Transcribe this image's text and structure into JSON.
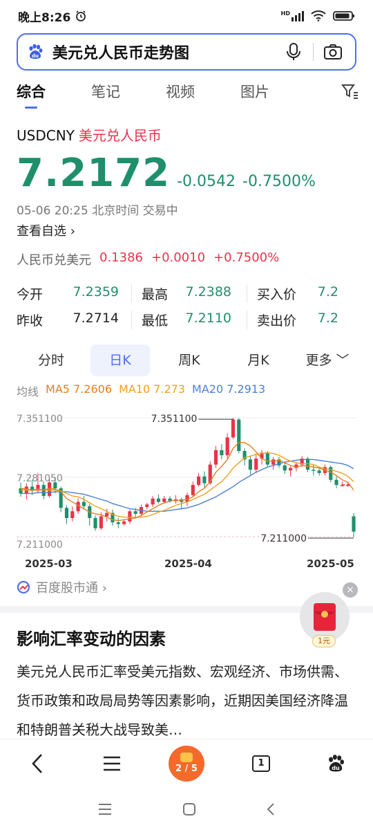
{
  "status": {
    "time": "晚上8:26",
    "net": "HD"
  },
  "search": {
    "query": "美元兑人民币走势图"
  },
  "tabs": [
    {
      "label": "综合"
    },
    {
      "label": "笔记"
    },
    {
      "label": "视频"
    },
    {
      "label": "图片"
    }
  ],
  "quote": {
    "symbol": "USDCNY",
    "name": "美元兑人民币",
    "price": "7.2172",
    "change": "-0.0542",
    "change_pct": "-0.7500%",
    "timestamp": "05-06 20:25 北京时间 交易中",
    "watchlist": "查看自选 ›",
    "reverse": {
      "label": "人民币兑美元",
      "price": "0.1386",
      "change": "+0.0010",
      "change_pct": "+0.7500%"
    },
    "stats": [
      {
        "k1": "今开",
        "v1": "7.2359",
        "k2": "最高",
        "v2": "7.2388",
        "k3": "买入价",
        "v3": "7.2"
      },
      {
        "k1": "昨收",
        "v1": "7.2714",
        "k2": "最低",
        "v2": "7.2110",
        "k3": "卖出价",
        "v3": "7.2"
      }
    ]
  },
  "period_tabs": [
    "分时",
    "日K",
    "周K",
    "月K",
    "更多 ﹀"
  ],
  "ma": {
    "label": "均线",
    "ma5": "MA5 7.2606",
    "ma10": "MA10 7.273",
    "ma20": "MA20 7.2913"
  },
  "chart_data": {
    "type": "candlestick",
    "y_ticks": [
      "7.351100",
      "7.281050",
      "7.211000"
    ],
    "x_ticks": [
      "2025-03",
      "2025-04",
      "2025-05"
    ],
    "ylim": [
      7.211,
      7.3511
    ],
    "max_label": "7.351100",
    "min_label": "7.211000",
    "candles": [
      [
        7.268,
        7.262,
        7.275,
        7.258
      ],
      [
        7.262,
        7.27,
        7.274,
        7.255
      ],
      [
        7.27,
        7.265,
        7.278,
        7.26
      ],
      [
        7.265,
        7.272,
        7.286,
        7.262
      ],
      [
        7.272,
        7.259,
        7.276,
        7.255
      ],
      [
        7.259,
        7.275,
        7.279,
        7.257
      ],
      [
        7.275,
        7.268,
        7.281,
        7.262
      ],
      [
        7.268,
        7.245,
        7.27,
        7.24
      ],
      [
        7.245,
        7.233,
        7.248,
        7.226
      ],
      [
        7.233,
        7.241,
        7.247,
        7.229
      ],
      [
        7.241,
        7.252,
        7.256,
        7.238
      ],
      [
        7.252,
        7.247,
        7.259,
        7.243
      ],
      [
        7.247,
        7.233,
        7.25,
        7.224
      ],
      [
        7.233,
        7.221,
        7.236,
        7.218
      ],
      [
        7.221,
        7.235,
        7.24,
        7.219
      ],
      [
        7.235,
        7.239,
        7.244,
        7.229
      ],
      [
        7.239,
        7.228,
        7.243,
        7.224
      ],
      [
        7.228,
        7.226,
        7.233,
        7.221
      ],
      [
        7.226,
        7.229,
        7.231,
        7.224
      ],
      [
        7.229,
        7.241,
        7.243,
        7.226
      ],
      [
        7.241,
        7.238,
        7.245,
        7.234
      ],
      [
        7.238,
        7.246,
        7.249,
        7.235
      ],
      [
        7.246,
        7.249,
        7.251,
        7.243
      ],
      [
        7.249,
        7.256,
        7.259,
        7.246
      ],
      [
        7.256,
        7.252,
        7.261,
        7.25
      ],
      [
        7.252,
        7.256,
        7.259,
        7.25
      ],
      [
        7.256,
        7.253,
        7.259,
        7.251
      ],
      [
        7.253,
        7.255,
        7.26,
        7.25
      ],
      [
        7.255,
        7.252,
        7.257,
        7.244
      ],
      [
        7.252,
        7.26,
        7.263,
        7.247
      ],
      [
        7.26,
        7.272,
        7.276,
        7.258
      ],
      [
        7.272,
        7.282,
        7.286,
        7.27
      ],
      [
        7.282,
        7.274,
        7.288,
        7.268
      ],
      [
        7.274,
        7.296,
        7.3,
        7.272
      ],
      [
        7.296,
        7.313,
        7.318,
        7.292
      ],
      [
        7.313,
        7.307,
        7.32,
        7.302
      ],
      [
        7.307,
        7.328,
        7.333,
        7.303
      ],
      [
        7.328,
        7.349,
        7.351,
        7.326
      ],
      [
        7.349,
        7.312,
        7.351,
        7.309
      ],
      [
        7.312,
        7.302,
        7.315,
        7.295
      ],
      [
        7.302,
        7.29,
        7.306,
        7.284
      ],
      [
        7.29,
        7.303,
        7.309,
        7.286
      ],
      [
        7.303,
        7.31,
        7.313,
        7.296
      ],
      [
        7.31,
        7.296,
        7.312,
        7.293
      ],
      [
        7.296,
        7.302,
        7.305,
        7.29
      ],
      [
        7.302,
        7.295,
        7.305,
        7.292
      ],
      [
        7.295,
        7.289,
        7.298,
        7.285
      ],
      [
        7.289,
        7.292,
        7.294,
        7.282
      ],
      [
        7.292,
        7.296,
        7.299,
        7.288
      ],
      [
        7.296,
        7.303,
        7.306,
        7.293
      ],
      [
        7.303,
        7.29,
        7.305,
        7.287
      ],
      [
        7.29,
        7.289,
        7.296,
        7.283
      ],
      [
        7.289,
        7.286,
        7.292,
        7.283
      ],
      [
        7.286,
        7.293,
        7.296,
        7.283
      ],
      [
        7.293,
        7.278,
        7.295,
        7.275
      ],
      [
        7.278,
        7.272,
        7.282,
        7.268
      ],
      [
        7.272,
        7.272,
        7.276,
        7.27
      ],
      [
        7.272,
        7.272,
        7.275,
        7.27
      ],
      [
        7.235,
        7.217,
        7.239,
        7.211
      ]
    ],
    "ma5": [
      7.268,
      7.267,
      7.266,
      7.267,
      7.266,
      7.268,
      7.267,
      7.264,
      7.256,
      7.252,
      7.248,
      7.244,
      7.24,
      7.238,
      7.237,
      7.234,
      7.231,
      7.23,
      7.231,
      7.232,
      7.233,
      7.236,
      7.24,
      7.244,
      7.248,
      7.251,
      7.253,
      7.254,
      7.254,
      7.255,
      7.258,
      7.264,
      7.268,
      7.276,
      7.287,
      7.294,
      7.302,
      7.315,
      7.322,
      7.322,
      7.318,
      7.311,
      7.303,
      7.3,
      7.3,
      7.301,
      7.298,
      7.295,
      7.293,
      7.295,
      7.294,
      7.293,
      7.292,
      7.289,
      7.287,
      7.283,
      7.278,
      7.275,
      7.266
    ],
    "ma10": [
      7.266,
      7.266,
      7.266,
      7.266,
      7.266,
      7.266,
      7.266,
      7.265,
      7.262,
      7.259,
      7.258,
      7.255,
      7.251,
      7.247,
      7.244,
      7.241,
      7.237,
      7.235,
      7.234,
      7.234,
      7.234,
      7.234,
      7.235,
      7.237,
      7.24,
      7.242,
      7.245,
      7.248,
      7.25,
      7.252,
      7.255,
      7.258,
      7.261,
      7.266,
      7.271,
      7.276,
      7.283,
      7.292,
      7.298,
      7.304,
      7.306,
      7.308,
      7.309,
      7.31,
      7.309,
      7.307,
      7.303,
      7.3,
      7.298,
      7.297,
      7.297,
      7.296,
      7.293,
      7.291,
      7.29,
      7.288,
      7.286,
      7.282,
      7.276
    ],
    "ma20": [
      7.262,
      7.262,
      7.262,
      7.263,
      7.263,
      7.263,
      7.264,
      7.264,
      7.264,
      7.263,
      7.262,
      7.261,
      7.259,
      7.257,
      7.255,
      7.253,
      7.25,
      7.248,
      7.246,
      7.244,
      7.243,
      7.242,
      7.241,
      7.241,
      7.241,
      7.241,
      7.242,
      7.243,
      7.244,
      7.245,
      7.247,
      7.249,
      7.252,
      7.255,
      7.258,
      7.262,
      7.266,
      7.27,
      7.275,
      7.279,
      7.283,
      7.287,
      7.29,
      7.293,
      7.295,
      7.297,
      7.299,
      7.3,
      7.301,
      7.302,
      7.302,
      7.302,
      7.301,
      7.3,
      7.299,
      7.298,
      7.297,
      7.295,
      7.291
    ]
  },
  "source": {
    "label": "百度股市通 ›"
  },
  "redpack": {
    "amount": "1元"
  },
  "article": {
    "title": "影响汇率变动的因素",
    "body": "美元兑人民币汇率受美元指数、宏观经济、市场供需、货币政策和政局局势等因素影响，近期因美国经济降温和特朗普关税大战导致美…"
  },
  "bottom_nav": {
    "pager": "2 / 5",
    "tab_count": "1"
  },
  "colors": {
    "up": "#e8334a",
    "down": "#1f8f6b",
    "accent": "#4e6ef2",
    "ma5": "#e67e22",
    "ma10": "#f0a020",
    "ma20": "#4a7fd6"
  }
}
